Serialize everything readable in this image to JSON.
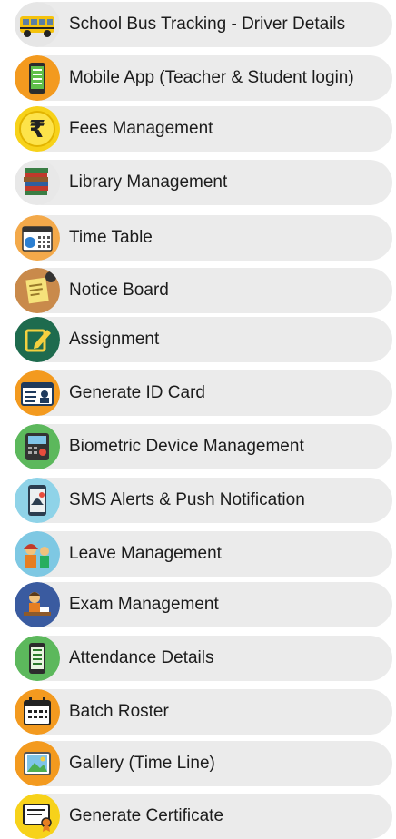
{
  "features": [
    {
      "label": "School Bus Tracking - Driver Details",
      "icon": "school-bus-icon"
    },
    {
      "label": "Mobile App (Teacher & Student login)",
      "icon": "mobile-app-icon"
    },
    {
      "label": "Fees Management",
      "icon": "rupee-icon"
    },
    {
      "label": "Library Management",
      "icon": "books-icon"
    },
    {
      "label": "Time Table",
      "icon": "calendar-icon"
    },
    {
      "label": "Notice Board",
      "icon": "notice-board-icon"
    },
    {
      "label": "Assignment",
      "icon": "assignment-icon"
    },
    {
      "label": "Generate ID Card",
      "icon": "id-card-icon"
    },
    {
      "label": "Biometric Device Management",
      "icon": "biometric-device-icon"
    },
    {
      "label": "SMS Alerts & Push Notification",
      "icon": "sms-alert-icon"
    },
    {
      "label": "Leave Management",
      "icon": "leave-icon"
    },
    {
      "label": "Exam Management",
      "icon": "exam-icon"
    },
    {
      "label": "Attendance Details",
      "icon": "attendance-icon"
    },
    {
      "label": "Batch Roster",
      "icon": "batch-roster-icon"
    },
    {
      "label": "Gallery (Time Line)",
      "icon": "gallery-icon"
    },
    {
      "label": "Generate Certificate",
      "icon": "certificate-icon"
    }
  ]
}
